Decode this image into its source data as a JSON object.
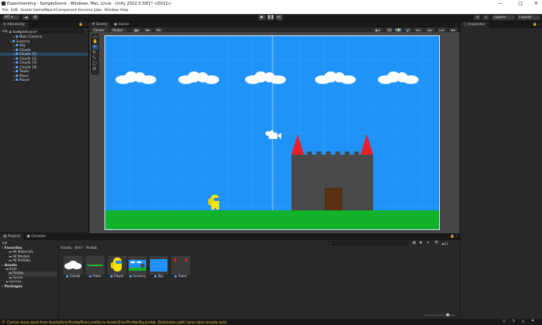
{
  "window": {
    "title": "Experimenting - SampleScene - Windows, Mac, Linux - Unity 2022.3.30f1* <DX11>",
    "controls": [
      "—",
      "□",
      "✕"
    ]
  },
  "menu": [
    "File",
    "Edit",
    "Assets",
    "GameObject",
    "Component",
    "Services",
    "Jobs",
    "Window",
    "Help"
  ],
  "toolbar": {
    "account": "MT ▾",
    "layers": "Layers",
    "layout": "Layout"
  },
  "hierarchy": {
    "tab": "Hierarchy",
    "search_placeholder": "All",
    "scene": "SampleScene*",
    "items": [
      {
        "label": "Main Camera",
        "indent": 2
      },
      {
        "label": "Scenery",
        "indent": 1
      },
      {
        "label": "Sky",
        "indent": 2
      },
      {
        "label": "Clouds",
        "indent": 2
      },
      {
        "label": "Clouds (1)",
        "indent": 2
      },
      {
        "label": "Clouds (2)",
        "indent": 2
      },
      {
        "label": "Clouds (3)",
        "indent": 2
      },
      {
        "label": "Clouds (4)",
        "indent": 2
      },
      {
        "label": "Tower",
        "indent": 2
      },
      {
        "label": "Place",
        "indent": 2
      },
      {
        "label": "Player",
        "indent": 2
      }
    ]
  },
  "scene": {
    "tabs": [
      "Scene",
      "Game"
    ],
    "pivot": "Center",
    "space": "Global",
    "mode_2d": "2D"
  },
  "inspector": {
    "tab": "Inspector"
  },
  "project": {
    "tabs": [
      "Project",
      "Console"
    ],
    "breadcrumb": [
      "Assets",
      "Emir",
      "Prefab"
    ],
    "count": "21",
    "tree": [
      {
        "label": "Favorites",
        "indent": 0,
        "bold": true
      },
      {
        "label": "All Materials",
        "indent": 2
      },
      {
        "label": "All Models",
        "indent": 2
      },
      {
        "label": "All Prefabs",
        "indent": 2
      },
      {
        "label": "Assets",
        "indent": 0,
        "bold": true
      },
      {
        "label": "Emir",
        "indent": 1
      },
      {
        "label": "Prefab",
        "indent": 2
      },
      {
        "label": "Scene",
        "indent": 2
      },
      {
        "label": "Scenes",
        "indent": 1
      },
      {
        "label": "Packages",
        "indent": 0,
        "bold": true
      }
    ],
    "assets": [
      "Clouds",
      "Place",
      "Player",
      "Scenery",
      "Sky",
      "Tower"
    ]
  },
  "status": {
    "message": "Cannot move asset from Assets/Emir/Prefab/Place.prefab to Assets/Emir/Prefab/Sky.prefab. Destination path name does already exist"
  },
  "colors": {
    "sky": "#1f93f9",
    "grass": "#12b32a",
    "tower": "#4a4a4a",
    "roof": "#e8202a",
    "door": "#5a3210",
    "player": "#f4e20a"
  }
}
